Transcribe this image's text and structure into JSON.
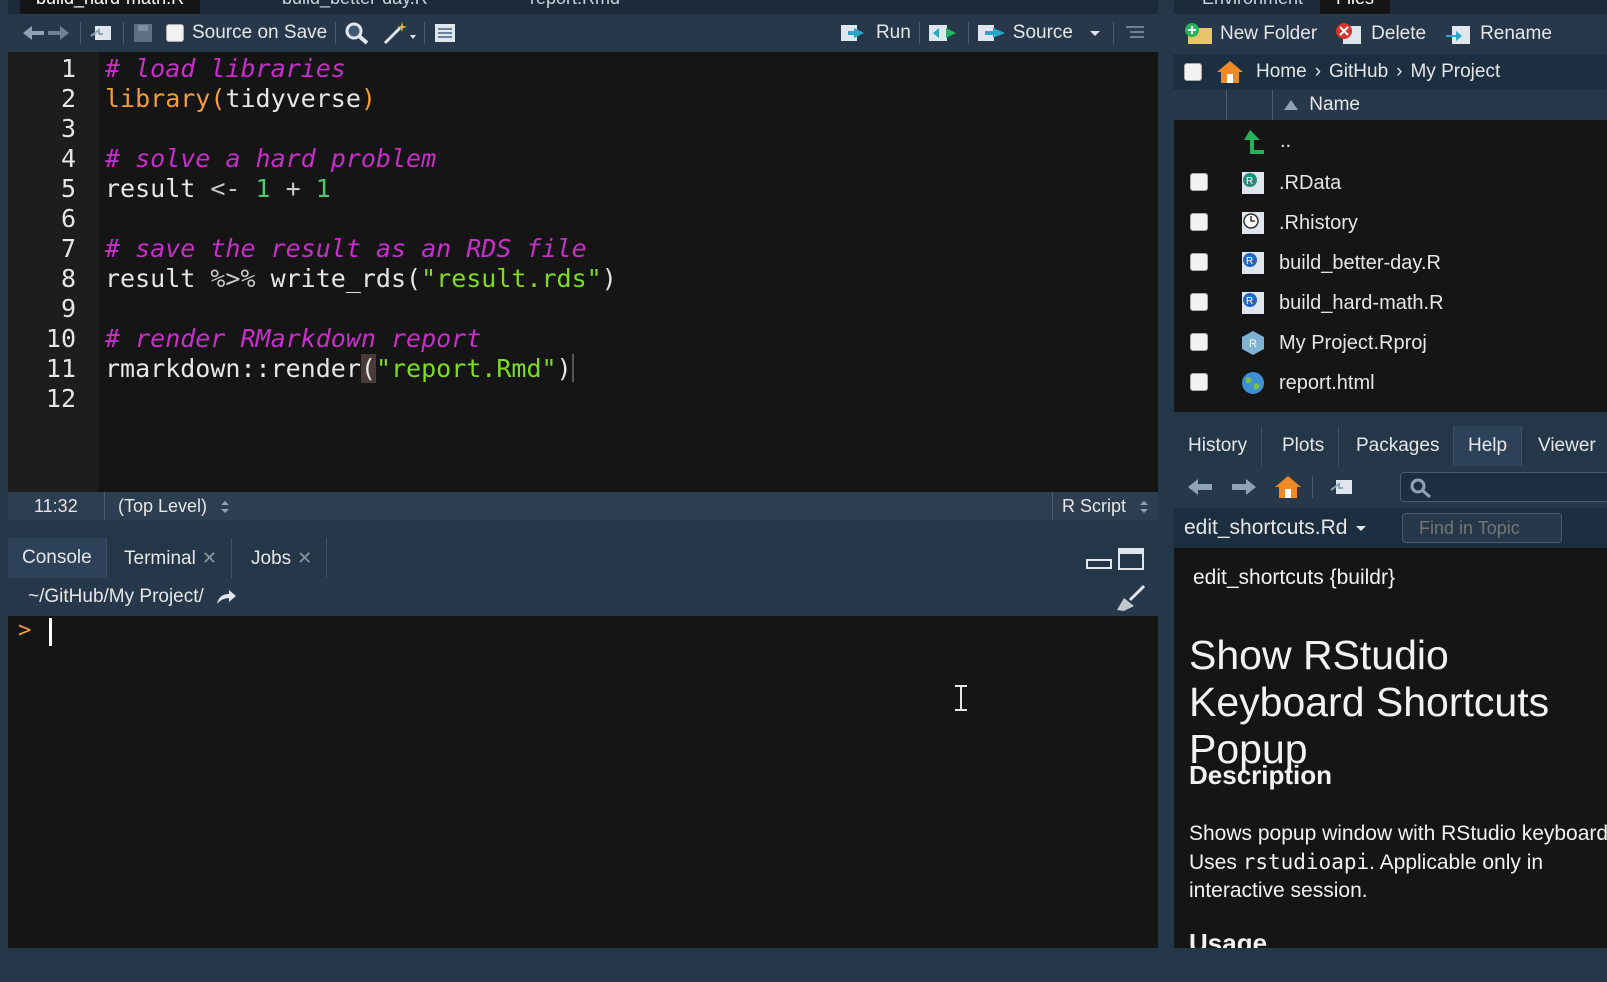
{
  "source": {
    "tabs": [
      "build_hard-math.R",
      "build_better-day.R",
      "report.Rmd"
    ],
    "toolbar": {
      "source_on_save": "Source on Save",
      "run": "Run",
      "source": "Source"
    },
    "line_numbers": [
      "1",
      "2",
      "3",
      "4",
      "5",
      "6",
      "7",
      "8",
      "9",
      "10",
      "11",
      "12"
    ],
    "code": {
      "l1_comment": "# load libraries",
      "l2_fn": "library",
      "l2_open": "(",
      "l2_arg": "tidyverse",
      "l2_close": ")",
      "l4_comment": "# solve a hard problem",
      "l5_var": "result ",
      "l5_assign": "<- ",
      "l5_n1": "1",
      "l5_plus": " + ",
      "l5_n2": "1",
      "l7_comment": "# save the result as an RDS file",
      "l8_var": "result ",
      "l8_pipe": "%>% ",
      "l8_fn": "write_rds(",
      "l8_str": "\"result.rds\"",
      "l8_close": ")",
      "l10_comment": "# render RMarkdown report",
      "l11_fn": "rmarkdown::render",
      "l11_open": "(",
      "l11_str": "\"report.Rmd\"",
      "l11_close": ")"
    },
    "status": {
      "position": "11:32",
      "scope": "(Top Level)",
      "filetype": "R Script"
    }
  },
  "console": {
    "tabs": [
      "Console",
      "Terminal",
      "Jobs"
    ],
    "path": "~/GitHub/My Project/",
    "prompt": ">"
  },
  "files": {
    "tabs": [
      "Environment",
      "Files"
    ],
    "toolbar": {
      "new_folder": "New Folder",
      "delete": "Delete",
      "rename": "Rename"
    },
    "breadcrumb": [
      "Home",
      "GitHub",
      "My Project"
    ],
    "column_name": "Name",
    "up_dir": "..",
    "items": [
      {
        "name": ".RData",
        "icon": "rdata-icon"
      },
      {
        "name": ".Rhistory",
        "icon": "history-file-icon"
      },
      {
        "name": "build_better-day.R",
        "icon": "r-script-icon"
      },
      {
        "name": "build_hard-math.R",
        "icon": "r-script-icon"
      },
      {
        "name": "My Project.Rproj",
        "icon": "rproj-icon"
      },
      {
        "name": "report.html",
        "icon": "html-globe-icon"
      }
    ]
  },
  "help": {
    "tabs": [
      "History",
      "Plots",
      "Packages",
      "Help",
      "Viewer"
    ],
    "topic": "edit_shortcuts.Rd",
    "find_placeholder": "Find in Topic",
    "pkg_title": "edit_shortcuts {buildr}",
    "title": "Show RStudio Keyboard Shortcuts Popup",
    "description_heading": "Description",
    "description_1": "Shows popup window with RStudio keyboard shortcuts.",
    "description_2_pre": "Uses ",
    "description_2_code": "rstudioapi",
    "description_2_post": ". Applicable only in interactive session.",
    "usage_heading": "Usage"
  },
  "colors": {
    "comment": "#c82fc8",
    "function": "#f39c3c",
    "number": "#4fc96f",
    "string": "#7fdc1f",
    "chrome": "#233749"
  }
}
